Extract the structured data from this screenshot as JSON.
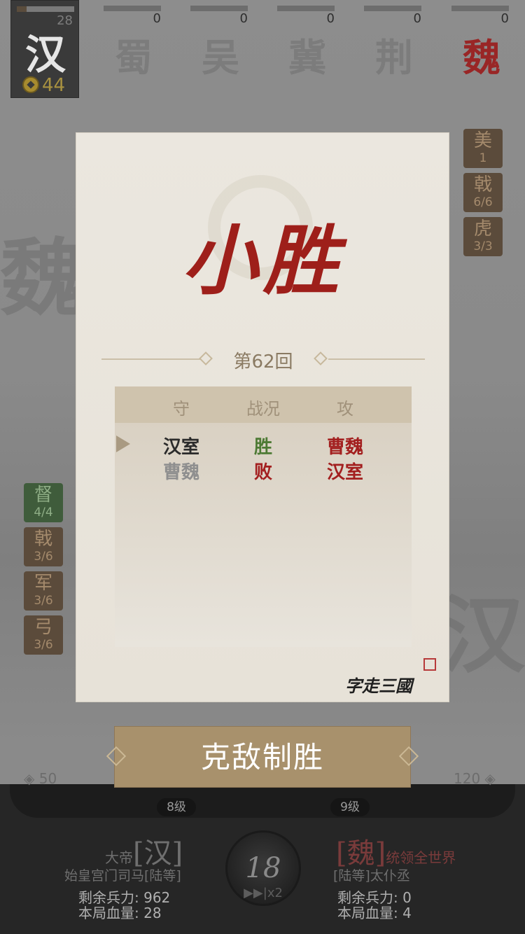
{
  "top_bar": {
    "player": {
      "score": "28",
      "glyph": "汉",
      "gold": "44"
    },
    "factions": [
      {
        "glyph": "蜀",
        "count": "0"
      },
      {
        "glyph": "吴",
        "count": "0"
      },
      {
        "glyph": "冀",
        "count": "0"
      },
      {
        "glyph": "荆",
        "count": "0"
      },
      {
        "glyph": "魏",
        "count": "0"
      }
    ]
  },
  "side_chips_right": [
    {
      "char": "美",
      "value": "1"
    },
    {
      "char": "戟",
      "value": "6/6"
    },
    {
      "char": "虎",
      "value": "3/3"
    }
  ],
  "side_chips_left": [
    {
      "char": "督",
      "value": "4/4"
    },
    {
      "char": "戟",
      "value": "3/6"
    },
    {
      "char": "军",
      "value": "3/6"
    },
    {
      "char": "弓",
      "value": "3/6"
    }
  ],
  "modal": {
    "result": "小胜",
    "round": "第62回",
    "table": {
      "headers": [
        "守",
        "战况",
        "攻"
      ],
      "rows": [
        {
          "defender": "汉室",
          "status": "胜",
          "attacker": "曹魏"
        },
        {
          "defender": "曹魏",
          "status": "败",
          "attacker": "汉室"
        }
      ]
    },
    "signature": "字走三國"
  },
  "cta": {
    "label": "克敌制胜"
  },
  "bottom": {
    "left_power": "50",
    "right_power": "120",
    "left_level": "8级",
    "right_level": "9级",
    "left": {
      "title_prefix": "大帝",
      "faction": "[汉]",
      "subtitle": "始皇宫门司马[陆等]",
      "troops_label": "剩余兵力:",
      "troops": "962",
      "hp_label": "本局血量:",
      "hp": "28"
    },
    "right": {
      "faction": "[魏]",
      "title_suffix": "统领全世界",
      "subtitle": "[陆等]太仆丞",
      "troops_label": "剩余兵力:",
      "troops": "0",
      "hp_label": "本局血量:",
      "hp": "4"
    },
    "turn": "18",
    "speed": "▶▶|x2"
  },
  "colors": {
    "title_red": "#9e1f1a",
    "win_green": "#4d7a34",
    "lose_red": "#a31f1f",
    "button": "#a8916c"
  }
}
